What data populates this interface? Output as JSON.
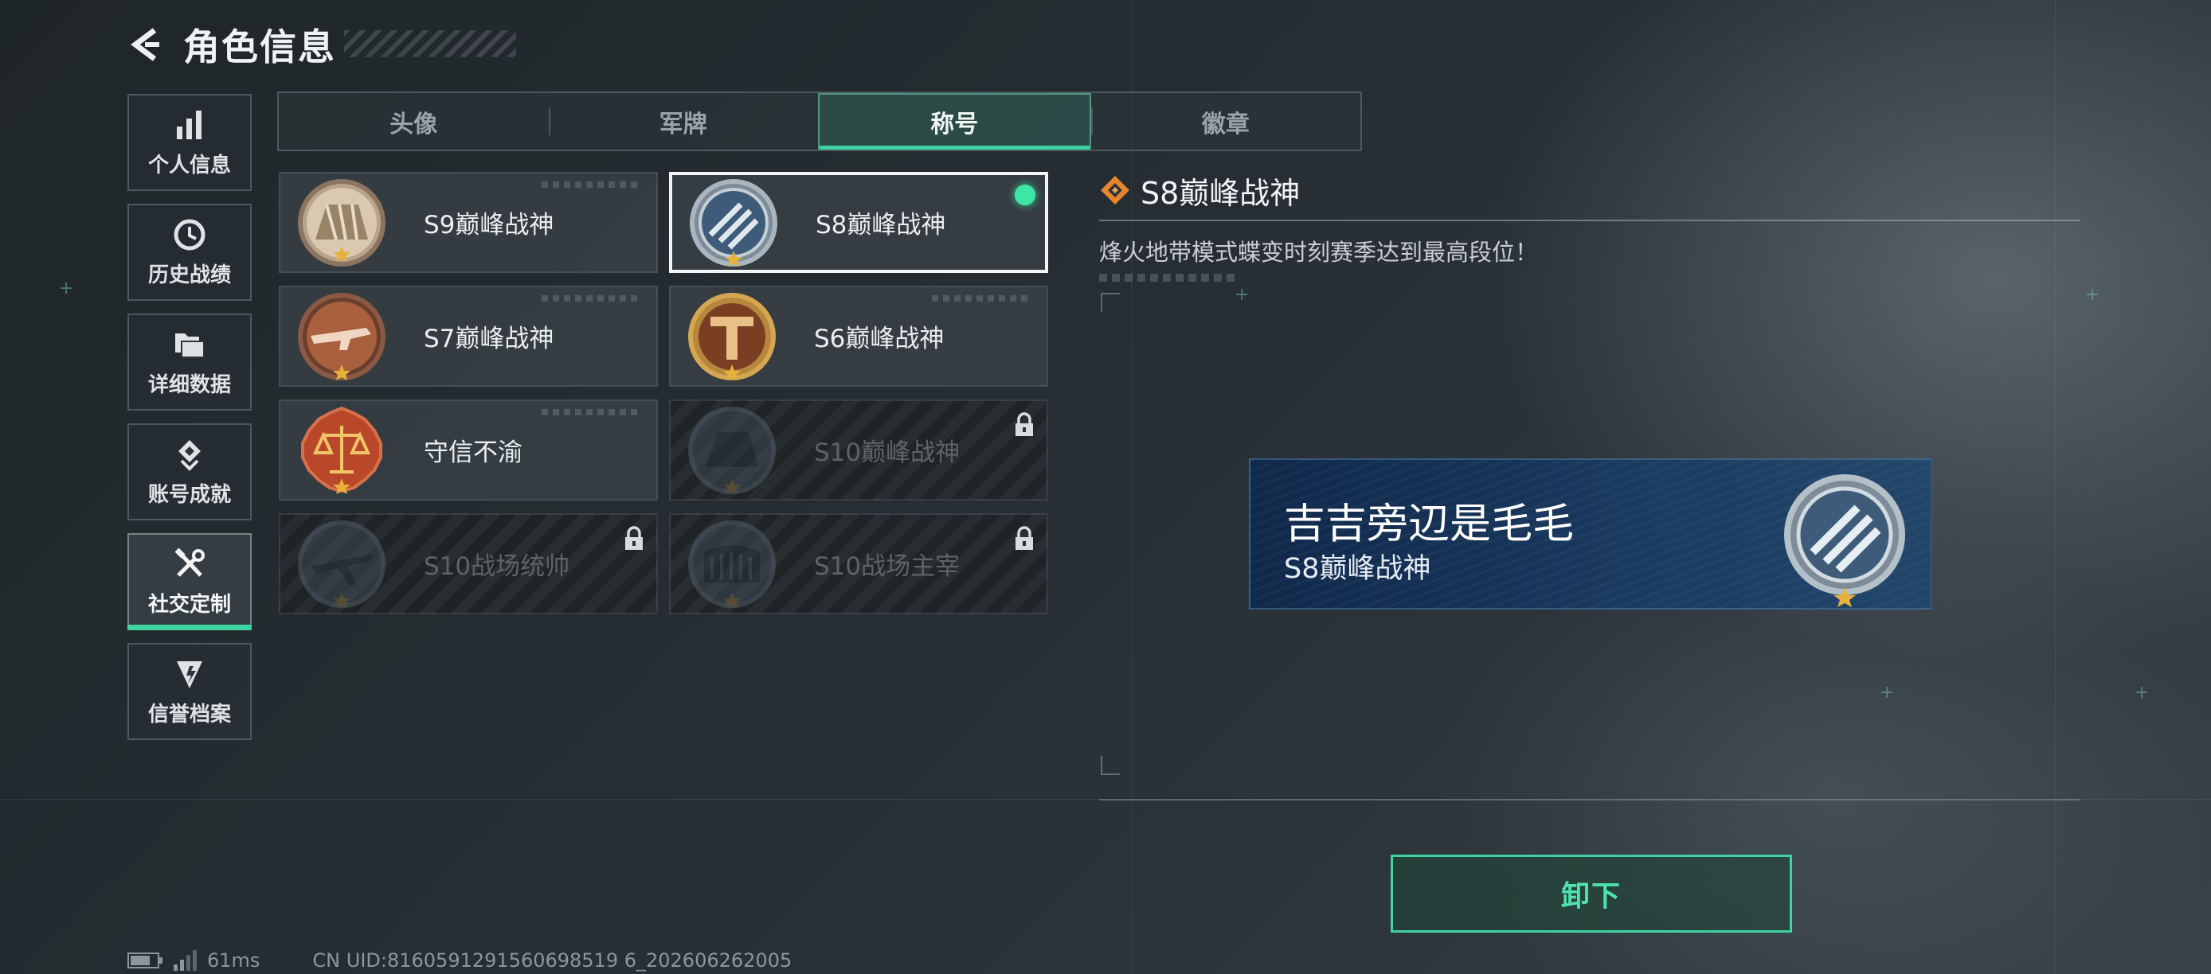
{
  "header": {
    "title": "角色信息"
  },
  "sidebar": {
    "items": [
      {
        "label": "个人信息",
        "icon": "bar-chart-icon",
        "active": false
      },
      {
        "label": "历史战绩",
        "icon": "history-clock-icon",
        "active": false
      },
      {
        "label": "详细数据",
        "icon": "folder-icon",
        "active": false
      },
      {
        "label": "账号成就",
        "icon": "achievement-icon",
        "active": false
      },
      {
        "label": "社交定制",
        "icon": "tools-icon",
        "active": true
      },
      {
        "label": "信誉档案",
        "icon": "shield-badge-icon",
        "active": false
      }
    ]
  },
  "tabs": [
    {
      "label": "头像",
      "active": false
    },
    {
      "label": "军牌",
      "active": false
    },
    {
      "label": "称号",
      "active": true
    },
    {
      "label": "徽章",
      "active": false
    }
  ],
  "titles": [
    {
      "label": "S9巅峰战神",
      "emblem": "dam-emblem-icon",
      "locked": false,
      "selected": false,
      "equipped": false
    },
    {
      "label": "S8巅峰战神",
      "emblem": "stripes-emblem-icon",
      "locked": false,
      "selected": true,
      "equipped": true
    },
    {
      "label": "S7巅峰战神",
      "emblem": "rifle-emblem-icon",
      "locked": false,
      "selected": false,
      "equipped": false
    },
    {
      "label": "S6巅峰战神",
      "emblem": "t-emblem-icon",
      "locked": false,
      "selected": false,
      "equipped": false
    },
    {
      "label": "守信不渝",
      "emblem": "scales-emblem-icon",
      "locked": false,
      "selected": false,
      "equipped": false
    },
    {
      "label": "S10巅峰战神",
      "emblem": "dam-emblem-icon",
      "locked": true,
      "selected": false,
      "equipped": false
    },
    {
      "label": "S10战场统帅",
      "emblem": "plane-emblem-icon",
      "locked": true,
      "selected": false,
      "equipped": false
    },
    {
      "label": "S10战场主宰",
      "emblem": "colosseum-emblem-icon",
      "locked": true,
      "selected": false,
      "equipped": false
    }
  ],
  "detail": {
    "title": "S8巅峰战神",
    "description": "烽火地带模式蝶变时刻赛季达到最高段位！"
  },
  "nameplate": {
    "player_name": "吉吉旁辺是毛毛",
    "title": "S8巅峰战神"
  },
  "actions": {
    "unequip_label": "卸下"
  },
  "status": {
    "ping": "61ms",
    "uid": "CN UID:8160591291560698519 6_202606262005"
  },
  "colors": {
    "accent": "#3ed3a0",
    "equipped_dot": "#3ee6a6",
    "nameplate_bg": "#16406e"
  }
}
